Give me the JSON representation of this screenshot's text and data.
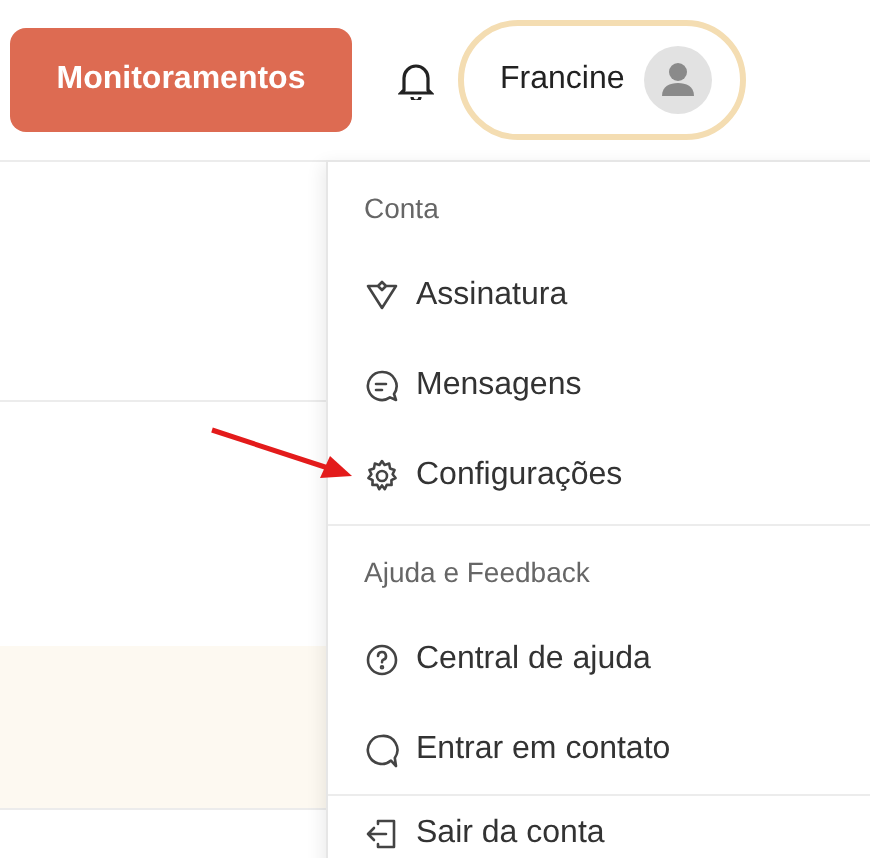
{
  "header": {
    "primary_button": "Monitoramentos",
    "user": {
      "name": "Francine"
    }
  },
  "menu": {
    "sections": [
      {
        "title": "Conta",
        "items": [
          {
            "kind": "diamond",
            "label": "Assinatura"
          },
          {
            "kind": "chat",
            "label": "Mensagens"
          },
          {
            "kind": "gear",
            "label": "Configurações"
          }
        ]
      },
      {
        "title": "Ajuda e Feedback",
        "items": [
          {
            "kind": "help",
            "label": "Central de ajuda"
          },
          {
            "kind": "bubble",
            "label": "Entrar em contato"
          }
        ]
      },
      {
        "items": [
          {
            "kind": "exit",
            "label": "Sair da conta"
          }
        ]
      }
    ]
  }
}
